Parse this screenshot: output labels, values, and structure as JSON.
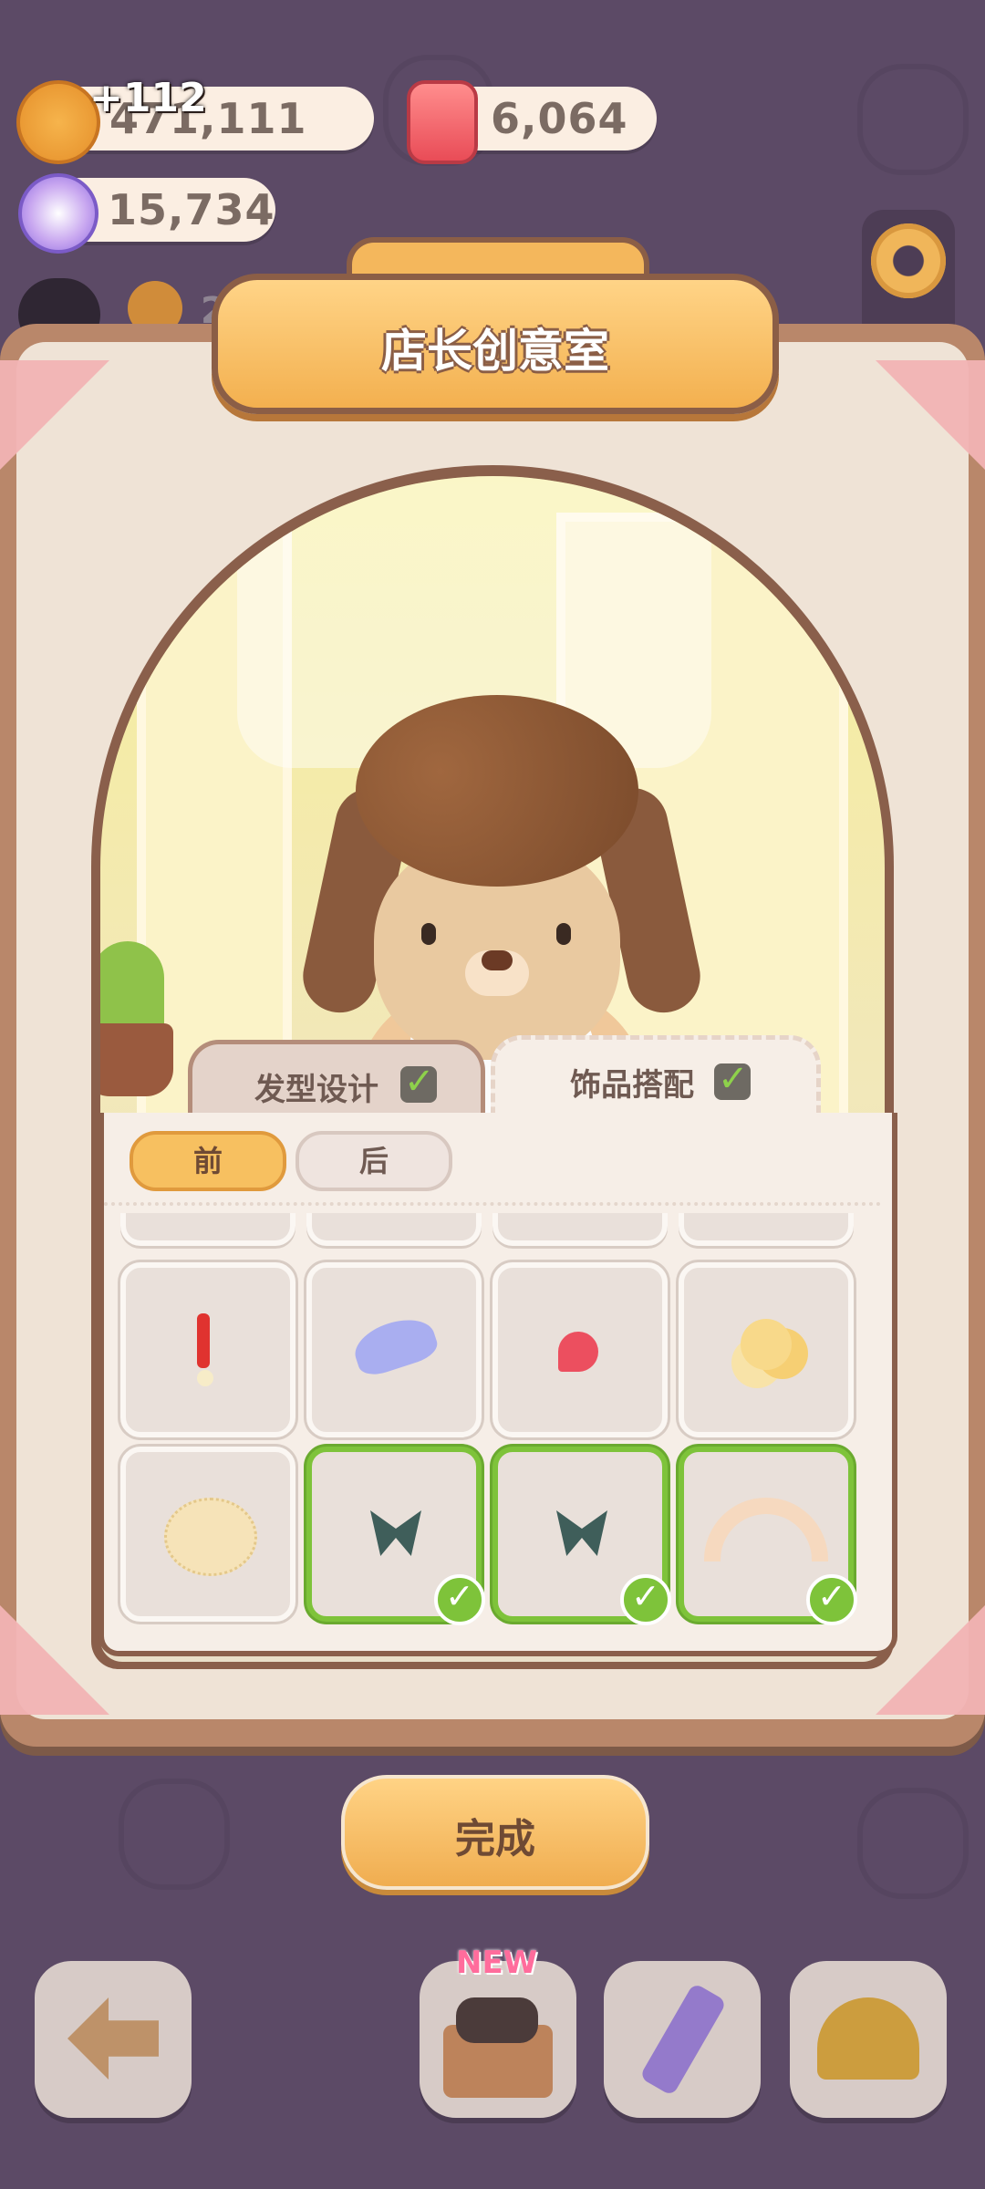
{
  "currencies": {
    "cookies": {
      "value": "471,111",
      "gain": "+112"
    },
    "gems": {
      "value": "6,064"
    },
    "candy": {
      "value": "15,734"
    }
  },
  "hud": {
    "partial_number": "2"
  },
  "title": "店长创意室",
  "tabs": [
    {
      "label": "发型设计",
      "checked": true,
      "active": false
    },
    {
      "label": "饰品搭配",
      "checked": true,
      "active": true
    }
  ],
  "segments": [
    {
      "label": "前",
      "active": true
    },
    {
      "label": "后",
      "active": false
    }
  ],
  "items": [
    {
      "icon": "red-ribbon-icon",
      "equipped": false
    },
    {
      "icon": "lavender-bow-icon",
      "equipped": false
    },
    {
      "icon": "strawberry-clip-icon",
      "equipped": false
    },
    {
      "icon": "yellow-flower-icon",
      "equipped": false
    },
    {
      "icon": "cream-bonnet-icon",
      "equipped": false
    },
    {
      "icon": "teal-bow-icon",
      "equipped": true
    },
    {
      "icon": "teal-bow-icon",
      "equipped": true
    },
    {
      "icon": "lace-headband-icon",
      "equipped": true
    }
  ],
  "done_label": "完成",
  "bottom_nav": {
    "new_badge": "NEW",
    "items": [
      "back-arrow-icon",
      "gift-box-icon",
      "pencil-ruler-icon",
      "hardhat-icon"
    ]
  },
  "colors": {
    "background": "#5c4a66",
    "accent_orange": "#f3b04f",
    "selected_green": "#7ec33a",
    "frame_brown": "#8a5f4b"
  }
}
